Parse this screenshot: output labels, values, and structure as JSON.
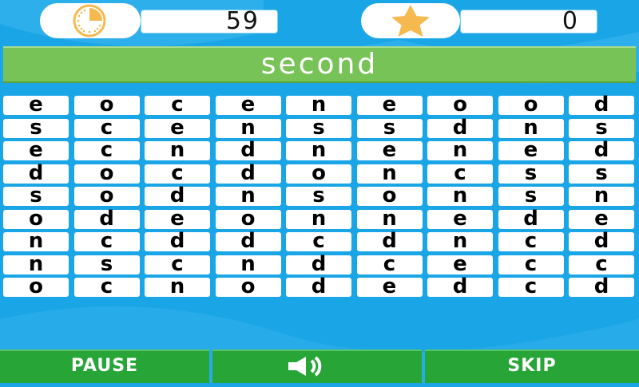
{
  "header": {
    "timer_value": "59",
    "score_value": "0",
    "timer_icon": "clock-icon",
    "score_icon": "star-icon"
  },
  "target_word": "second",
  "grid": [
    [
      "e",
      "o",
      "c",
      "e",
      "n",
      "e",
      "o",
      "o",
      "d"
    ],
    [
      "s",
      "c",
      "e",
      "n",
      "s",
      "s",
      "d",
      "n",
      "s"
    ],
    [
      "e",
      "c",
      "n",
      "d",
      "n",
      "e",
      "n",
      "e",
      "d"
    ],
    [
      "d",
      "o",
      "c",
      "d",
      "o",
      "n",
      "c",
      "s",
      "s"
    ],
    [
      "s",
      "o",
      "d",
      "n",
      "s",
      "o",
      "n",
      "s",
      "n"
    ],
    [
      "o",
      "d",
      "e",
      "o",
      "n",
      "n",
      "e",
      "d",
      "e"
    ],
    [
      "n",
      "c",
      "d",
      "d",
      "c",
      "d",
      "n",
      "c",
      "d"
    ],
    [
      "n",
      "s",
      "c",
      "n",
      "d",
      "c",
      "e",
      "c",
      "c"
    ],
    [
      "o",
      "c",
      "n",
      "o",
      "d",
      "e",
      "d",
      "c",
      "d"
    ]
  ],
  "buttons": {
    "pause_label": "PAUSE",
    "sound_icon": "speaker-icon",
    "skip_label": "SKIP"
  },
  "colors": {
    "background": "#1aa6e6",
    "banner": "#78c357",
    "button": "#27a537",
    "timer_accent": "#f5b94f",
    "star": "#f5b94f"
  }
}
